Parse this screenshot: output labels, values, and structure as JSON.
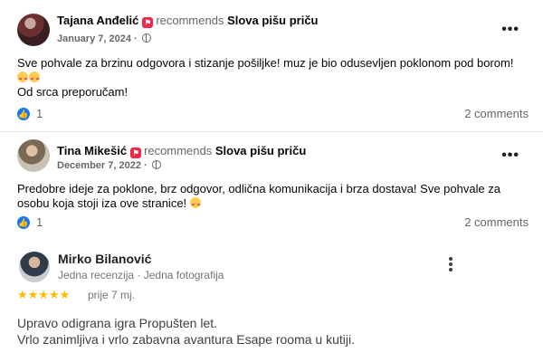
{
  "reviews": [
    {
      "name": "Tajana Anđelić",
      "recommends": "recommends",
      "page": "Slova pišu priču",
      "date": "January 7, 2024 ·",
      "text_line1": "Sve pohvale za brzinu odgovora i stizanje pošiljke! muz je bio odusevljen poklonom pod borom!",
      "text_line3": "Od srca preporučam!",
      "likes": "1",
      "comments": "2 comments"
    },
    {
      "name": "Tina Mikešić",
      "recommends": "recommends",
      "page": "Slova pišu priču",
      "date": "December 7, 2022 ·",
      "text": "Predobre ideje za poklone, brz odgovor, odlična komunikacija i brza dostava! Sve pohvale za osobu koja stoji iza ove stranice!",
      "likes": "1",
      "comments": "2 comments"
    }
  ],
  "google_review": {
    "name": "Mirko Bilanović",
    "meta": "Jedna recenzija · Jedna fotografija",
    "rating": 5,
    "stars": "★★★★★",
    "relative_date": "prije 7 mj.",
    "text_line1": "Upravo odigrana igra Propušten let.",
    "text_line2": "Vrlo zanimljiva i vrlo zabavna avantura Esape rooma u kutiji."
  },
  "icons": {
    "like": "thumbs-up-icon",
    "recommend": "recommend-flag-icon",
    "privacy": "globe-icon",
    "more": "more-options-icon",
    "star_color": "#fbbc04",
    "like_color": "#1877f2",
    "recommend_color": "#f02849"
  }
}
